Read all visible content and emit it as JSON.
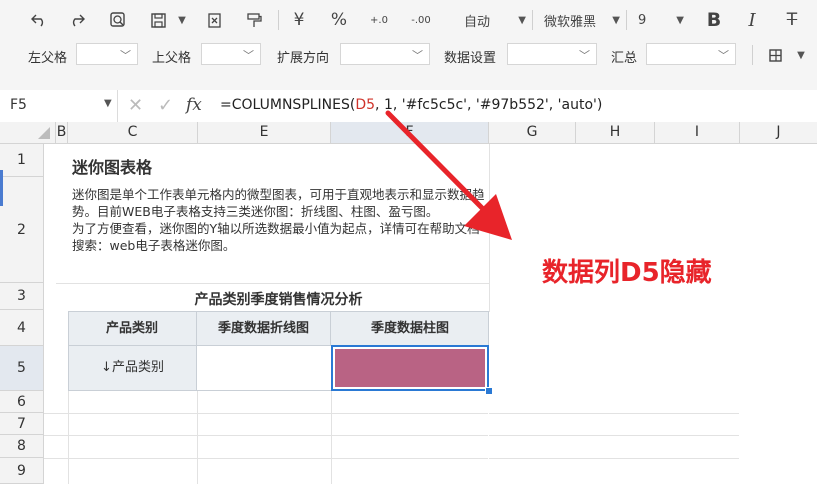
{
  "toolbar": {
    "row1": {
      "undo_icon": "undo-icon",
      "redo_icon": "redo-icon",
      "currency_symbol": "¥",
      "percent_symbol": "%",
      "decimal_increase": "+.0",
      "decimal_decrease": "-.00",
      "number_format": "自动",
      "font_family": "微软雅黑",
      "font_size": "9",
      "bold": "B",
      "italic": "I",
      "strike": "T"
    },
    "row2": {
      "left_parent_label": "左父格",
      "top_parent_label": "上父格",
      "expand_label": "扩展方向",
      "data_setting_label": "数据设置",
      "summary_label": "汇总"
    }
  },
  "formula_bar": {
    "cell_ref": "F5",
    "fx_label": "fx",
    "formula_prefix": "=COLUMNSPLINES(",
    "formula_ref": "D5",
    "formula_suffix": ", 1, '#fc5c5c', '#97b552', 'auto')"
  },
  "columns": [
    "B",
    "C",
    "E",
    "F",
    "G",
    "H",
    "I",
    "J"
  ],
  "rows": [
    "1",
    "2",
    "3",
    "4",
    "5",
    "6",
    "7",
    "8",
    "9"
  ],
  "sheet": {
    "title": "迷你图表格",
    "description": "迷你图是单个工作表单元格内的微型图表，可用于直观地表示和显示数据趋势。目前WEB电子表格支持三类迷你图：折线图、柱图、盈亏图。\n为了方便查看，迷你图的Y轴以所选数据最小值为起点，详情可在帮助文档搜索：web电子表格迷你图。",
    "table_title": "产品类别季度销售情况分析",
    "table_headers": [
      "产品类别",
      "季度数据折线图",
      "季度数据柱图"
    ],
    "row5_label": "↓产品类别"
  },
  "annotation": {
    "text": "数据列D5隐藏"
  },
  "colors": {
    "accent_red": "#e8242a",
    "bar_fill": "#b96384",
    "selection_blue": "#2a79d4",
    "header_fill": "#eaeef2"
  }
}
